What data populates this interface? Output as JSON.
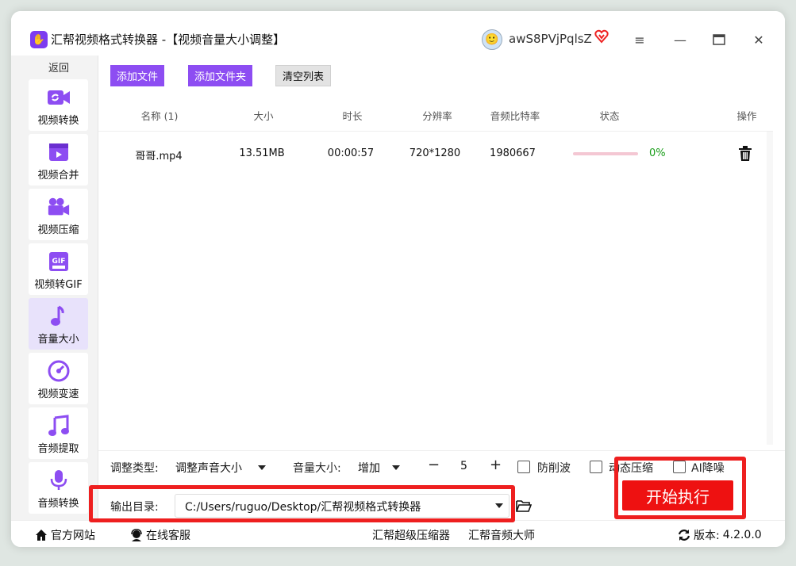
{
  "app": {
    "title": "汇帮视频格式转换器 -【视频音量大小调整】",
    "username": "awS8PVjPqlsZ"
  },
  "colors": {
    "accent": "#8d4df2",
    "start_button": "#ee1111",
    "progress_text": "#1a9e1a"
  },
  "sidebar": {
    "back_label": "返回",
    "items": [
      {
        "label": "视频转换",
        "icon": "video-convert-icon"
      },
      {
        "label": "视频合并",
        "icon": "video-merge-icon"
      },
      {
        "label": "视频压缩",
        "icon": "video-compress-icon"
      },
      {
        "label": "视频转GIF",
        "icon": "gif-icon"
      },
      {
        "label": "音量大小",
        "icon": "music-note-icon",
        "active": true
      },
      {
        "label": "视频变速",
        "icon": "speedometer-icon"
      },
      {
        "label": "音频提取",
        "icon": "music-extract-icon"
      },
      {
        "label": "音频转换",
        "icon": "microphone-icon"
      }
    ]
  },
  "toolbar": {
    "add_file": "添加文件",
    "add_folder": "添加文件夹",
    "clear_list": "清空列表"
  },
  "table": {
    "headers": {
      "name": "名称 (1)",
      "size": "大小",
      "duration": "时长",
      "resolution": "分辨率",
      "bitrate": "音频比特率",
      "status": "状态",
      "action": "操作"
    },
    "rows": [
      {
        "name": "哥哥.mp4",
        "size": "13.51MB",
        "duration": "00:00:57",
        "resolution": "720*1280",
        "bitrate": "1980667",
        "progress": 0,
        "progress_text": "0%"
      }
    ]
  },
  "settings": {
    "adjust_type_label": "调整类型:",
    "adjust_type_value": "调整声音大小",
    "volume_label": "音量大小:",
    "volume_mode": "增加",
    "volume_value": "5",
    "minus": "−",
    "plus": "+",
    "anti_clip_label": "防削波",
    "dynamic_compress_label": "动态压缩",
    "ai_denoise_label": "AI降噪",
    "output_label": "输出目录:",
    "output_path": "C:/Users/ruguo/Desktop/汇帮视频格式转换器"
  },
  "actions": {
    "start": "开始执行"
  },
  "footer": {
    "website": "官方网站",
    "support": "在线客服",
    "compressor": "汇帮超级压缩器",
    "audio_master": "汇帮音频大师",
    "version_label": "版本:",
    "version": "4.2.0.0"
  }
}
